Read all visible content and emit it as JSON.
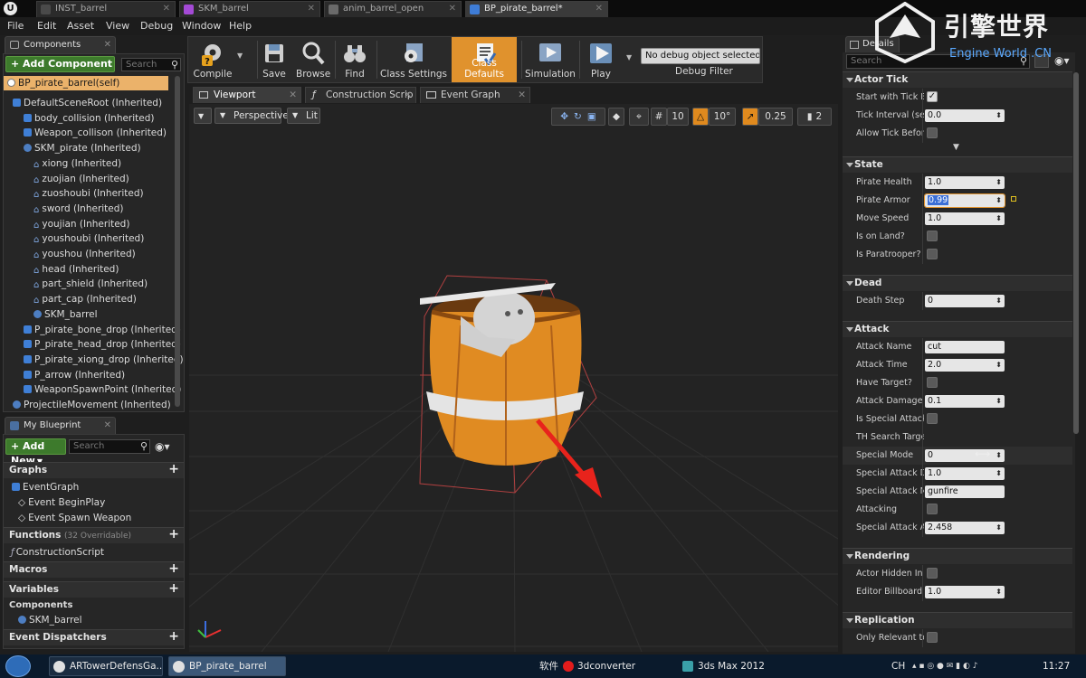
{
  "doc_tabs": [
    {
      "label": "INST_barrel",
      "color": "#4a4a4a"
    },
    {
      "label": "SKM_barrel",
      "color": "#a44ad6"
    },
    {
      "label": "anim_barrel_open",
      "color": "#6a6a6a"
    },
    {
      "label": "BP_pirate_barrel*",
      "color": "#3e7cd6"
    }
  ],
  "menu": [
    "File",
    "Edit",
    "Asset",
    "View",
    "Debug",
    "Window",
    "Help"
  ],
  "logo": {
    "title": "引擎世界",
    "subtitle": "Engine World .CN"
  },
  "components": {
    "tab_label": "Components",
    "add_label": "+ Add Component",
    "search_placeholder": "Search",
    "self_label": "BP_pirate_barrel(self)",
    "tree": [
      {
        "label": "DefaultSceneRoot (Inherited)",
        "indent": 0,
        "icon": "scene-root-icon"
      },
      {
        "label": "body_collision (Inherited)",
        "indent": 1,
        "icon": "box-component-icon"
      },
      {
        "label": "Weapon_collison (Inherited)",
        "indent": 1,
        "icon": "box-component-icon"
      },
      {
        "label": "SKM_pirate (Inherited)",
        "indent": 1,
        "icon": "skeletal-mesh-icon"
      },
      {
        "label": "xiong (Inherited)",
        "indent": 2,
        "icon": "mesh-icon"
      },
      {
        "label": "zuojian (Inherited)",
        "indent": 2,
        "icon": "mesh-icon"
      },
      {
        "label": "zuoshoubi (Inherited)",
        "indent": 2,
        "icon": "mesh-icon"
      },
      {
        "label": "sword (Inherited)",
        "indent": 2,
        "icon": "mesh-icon"
      },
      {
        "label": "youjian (Inherited)",
        "indent": 2,
        "icon": "mesh-icon"
      },
      {
        "label": "youshoubi (Inherited)",
        "indent": 2,
        "icon": "mesh-icon"
      },
      {
        "label": "youshou (Inherited)",
        "indent": 2,
        "icon": "mesh-icon"
      },
      {
        "label": "head (Inherited)",
        "indent": 2,
        "icon": "mesh-icon"
      },
      {
        "label": "part_shield (Inherited)",
        "indent": 2,
        "icon": "mesh-icon"
      },
      {
        "label": "part_cap (Inherited)",
        "indent": 2,
        "icon": "mesh-icon"
      },
      {
        "label": "SKM_barrel",
        "indent": 2,
        "icon": "skeletal-mesh-icon"
      },
      {
        "label": "P_pirate_bone_drop (Inherited)",
        "indent": 1,
        "icon": "particle-icon"
      },
      {
        "label": "P_pirate_head_drop (Inherited)",
        "indent": 1,
        "icon": "particle-icon"
      },
      {
        "label": "P_pirate_xiong_drop (Inherited)",
        "indent": 1,
        "icon": "particle-icon"
      },
      {
        "label": "P_arrow (Inherited)",
        "indent": 1,
        "icon": "arrow-component-icon"
      },
      {
        "label": "WeaponSpawnPoint (Inherited)",
        "indent": 1,
        "icon": "scene-component-icon"
      },
      {
        "label": "ProjectileMovement (Inherited)",
        "indent": 0,
        "icon": "movement-component-icon"
      }
    ]
  },
  "my_blueprint": {
    "tab_label": "My Blueprint",
    "add_label": "+ Add New",
    "search_placeholder": "Search",
    "graphs_label": "Graphs",
    "event_graph": "EventGraph",
    "events": [
      "Event BeginPlay",
      "Event Spawn Weapon"
    ],
    "functions_label": "Functions",
    "functions_sub": "(32 Overridable)",
    "construction_script": "ConstructionScript",
    "macros_label": "Macros",
    "variables_label": "Variables",
    "var_components_label": "Components",
    "var_component_item": "SKM_barrel",
    "dispatchers_label": "Event Dispatchers"
  },
  "toolbar": {
    "compile": "Compile",
    "save": "Save",
    "browse": "Browse",
    "find": "Find",
    "class_settings": "Class Settings",
    "class_defaults": "Class Defaults",
    "simulation": "Simulation",
    "play": "Play",
    "debug_select": "No debug object selected",
    "debug_filter": "Debug Filter"
  },
  "editor_tabs": [
    "Viewport",
    "Construction Scrip",
    "Event Graph"
  ],
  "viewport": {
    "perspective": "Perspective",
    "lit": "Lit",
    "grid_snap": "10",
    "rot_snap": "10°",
    "scale_snap": "0.25",
    "cam_speed": "2"
  },
  "details": {
    "tab_label": "Details",
    "search_placeholder": "Search",
    "sections": {
      "actor_tick": "Actor Tick",
      "state": "State",
      "dead": "Dead",
      "attack": "Attack",
      "rendering": "Rendering",
      "replication": "Replication"
    },
    "actor_tick": {
      "start_with_tick": "Start with Tick En",
      "tick_interval_label": "Tick Interval (sec",
      "tick_interval_value": "0.0",
      "allow_tick_before": "Allow Tick Before"
    },
    "state": {
      "pirate_health_label": "Pirate Health",
      "pirate_health_value": "1.0",
      "pirate_armor_label": "Pirate Armor",
      "pirate_armor_value": "0.99",
      "move_speed_label": "Move Speed",
      "move_speed_value": "1.0",
      "is_on_land_label": "Is on Land?",
      "is_paratrooper_label": "Is Paratrooper?"
    },
    "dead": {
      "death_step_label": "Death Step",
      "death_step_value": "0"
    },
    "attack": {
      "attack_name_label": "Attack Name",
      "attack_name_value": "cut",
      "attack_time_label": "Attack Time",
      "attack_time_value": "2.0",
      "have_target_label": "Have Target?",
      "attack_damage_label": "Attack Damage",
      "attack_damage_value": "0.1",
      "is_special_attack_label": "Is Special Attack?",
      "th_search_target_label": "TH Search Target",
      "special_mode_label": "Special Mode",
      "special_mode_value": "0",
      "special_attack_de_label": "Special Attack De",
      "special_attack_de_value": "1.0",
      "special_attack_na_label": "Special Attack Na",
      "special_attack_na_value": "gunfire",
      "attacking_label": "Attacking",
      "special_attack_ai_label": "Special Attack Ai",
      "special_attack_ai_value": "2.458"
    },
    "rendering": {
      "actor_hidden_label": "Actor Hidden In Ga",
      "editor_billboard_label": "Editor Billboard Sc",
      "editor_billboard_value": "1.0"
    },
    "replication": {
      "only_relevant_label": "Only Relevant to O"
    }
  },
  "taskbar": {
    "task1": "ARTowerDefensGa...",
    "task2": "BP_pirate_barrel",
    "software_label": "软件",
    "app_3dconverter": "3dconverter",
    "app_3dsmax": "3ds Max 2012",
    "lang": "CH",
    "time": "11:27"
  },
  "colors": {
    "accent_orange": "#e0922d",
    "selection": "#ebb26a",
    "add_green": "#3d7a2c",
    "gizmo_red": "#e8231c"
  }
}
